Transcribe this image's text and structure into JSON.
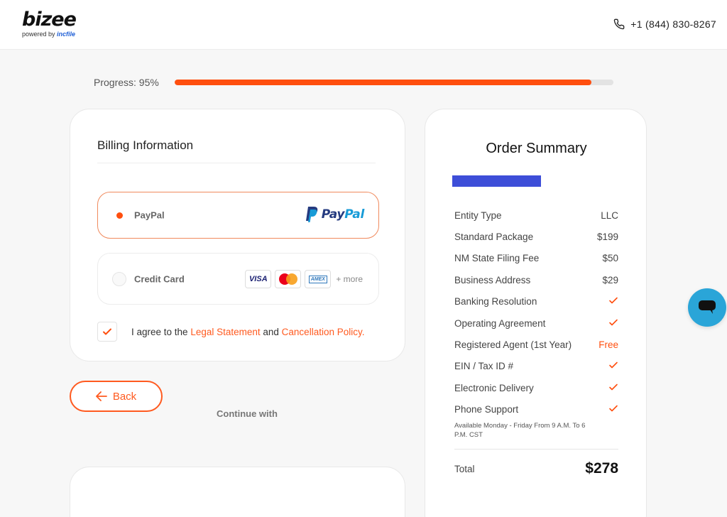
{
  "header": {
    "logo_word": "bizee",
    "logo_sub_prefix": "powered by",
    "logo_sub_brand": "incfile",
    "phone": "+1 (844) 830-8267"
  },
  "progress": {
    "label": "Progress: 95%",
    "value": 95
  },
  "billing": {
    "title": "Billing Information",
    "paypal_label": "PayPal",
    "paypal_logo_left": "Pay",
    "paypal_logo_right": "Pal",
    "credit_card_label": "Credit Card",
    "card_brands": [
      "VISA",
      "Mastercard",
      "AMEX"
    ],
    "visa_text": "VISA",
    "amex_text": "AMEX",
    "more_text": "+ more",
    "agree_prefix": "I agree to the ",
    "legal_link": "Legal Statement",
    "agree_mid": " and ",
    "cancel_link": "Cancellation Policy."
  },
  "actions": {
    "back_label": "Back",
    "continue_label": "Continue with"
  },
  "summary": {
    "title": "Order Summary",
    "rows": [
      {
        "label": "Entity Type",
        "value": "LLC"
      },
      {
        "label": "Standard Package",
        "value": "$199"
      },
      {
        "label": "NM State Filing Fee",
        "value": "$50"
      },
      {
        "label": "Business Address",
        "value": "$29"
      },
      {
        "label": "Banking Resolution",
        "value": "check"
      },
      {
        "label": "Operating Agreement",
        "value": "check"
      },
      {
        "label": "Registered Agent (1st Year)",
        "value": "Free"
      },
      {
        "label": "EIN / Tax ID #",
        "value": "check"
      },
      {
        "label": "Electronic Delivery",
        "value": "check"
      },
      {
        "label": "Phone Support",
        "value": "check"
      }
    ],
    "support_note": "Available Monday - Friday From 9 A.M. To 6 P.M. CST",
    "total_label": "Total",
    "total_value": "$278"
  },
  "colors": {
    "accent": "#ff4f0f",
    "summary_bar": "#3d4ed8",
    "chat": "#2aa5d8"
  },
  "icons": [
    "phone-icon",
    "paypal-icon",
    "check-icon",
    "arrow-left-icon",
    "chat-icon"
  ]
}
